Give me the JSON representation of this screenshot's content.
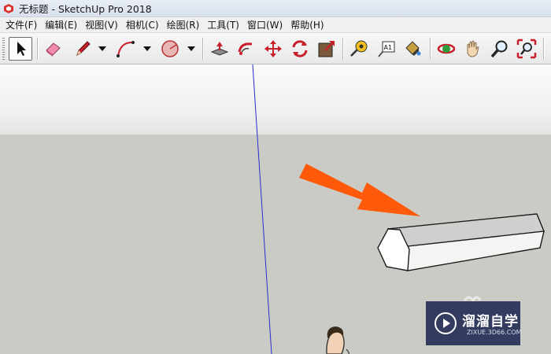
{
  "window": {
    "title": "无标题 - SketchUp Pro 2018"
  },
  "menu": [
    "文件(F)",
    "编辑(E)",
    "视图(V)",
    "相机(C)",
    "绘图(R)",
    "工具(T)",
    "窗口(W)",
    "帮助(H)"
  ],
  "toolbar": {
    "tools": [
      "select",
      "eraser",
      "pencil",
      "arc",
      "shapes",
      "push-pull",
      "follow-me",
      "move",
      "rotate",
      "scale",
      "tape-measure",
      "text",
      "paint-bucket",
      "orbit",
      "pan",
      "zoom",
      "zoom-extents"
    ],
    "selected": "select",
    "text_tool_glyph": "A1"
  },
  "colors": {
    "accent_arrow": "#ff5a0a",
    "axis_blue": "#2b2bd1",
    "sky": "#f4f5f5",
    "ground": "#cbcbc6"
  },
  "watermark": {
    "title": "溜溜自学",
    "subtitle": "ZIXUE.3D66.COM"
  }
}
